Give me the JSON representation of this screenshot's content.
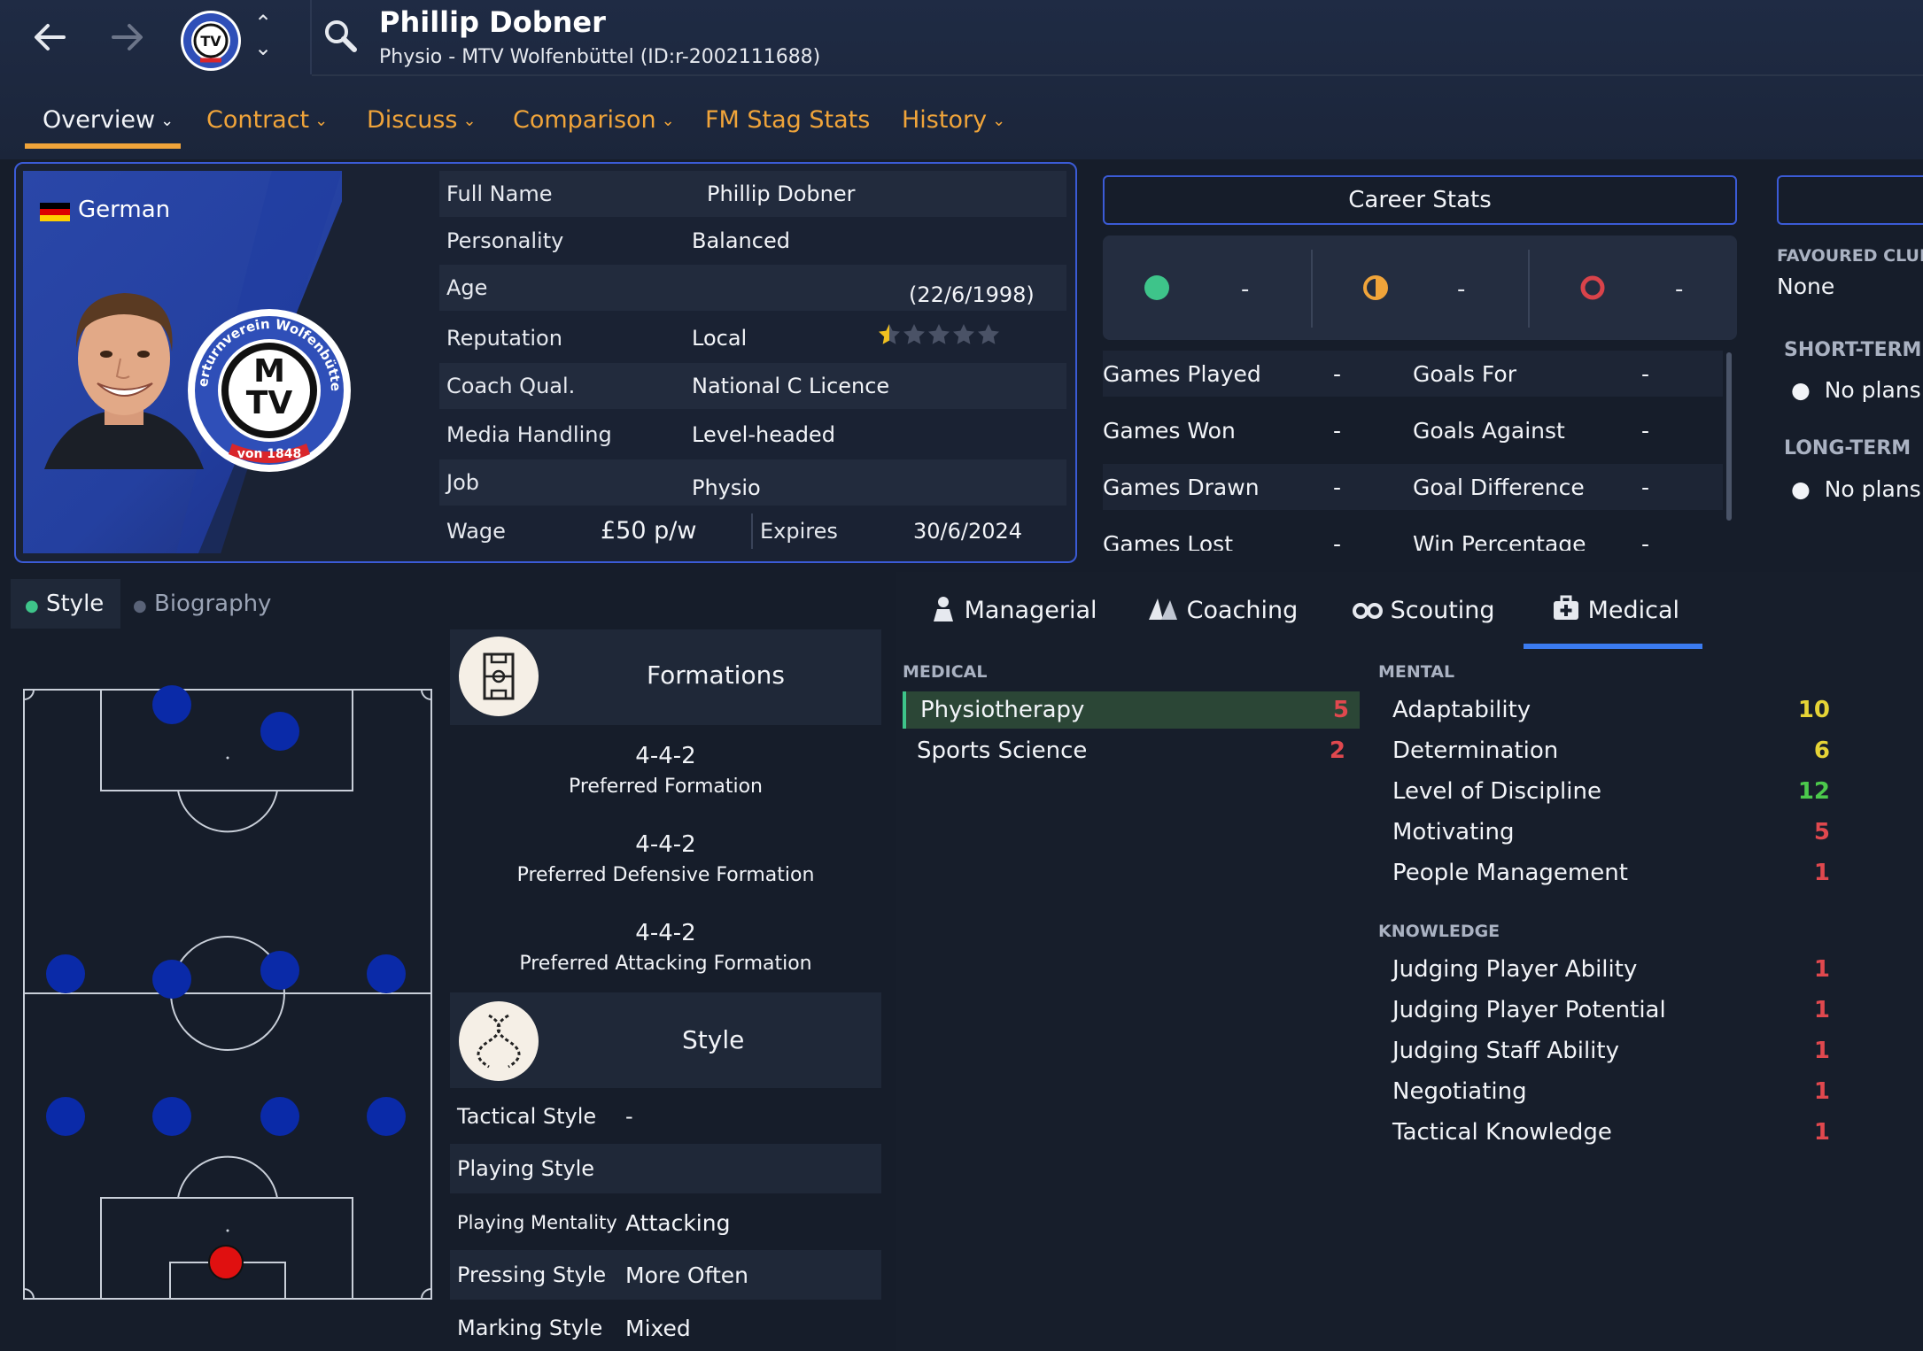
{
  "header": {
    "name": "Phillip Dobner",
    "subtitle": "Physio - MTV Wolfenbüttel (ID:r-2002111688)",
    "tabs": [
      {
        "label": "Overview",
        "dropdown": true,
        "active": true
      },
      {
        "label": "Contract",
        "dropdown": true
      },
      {
        "label": "Discuss",
        "dropdown": true
      },
      {
        "label": "Comparison",
        "dropdown": true
      },
      {
        "label": "FM Stag Stats",
        "dropdown": false
      },
      {
        "label": "History",
        "dropdown": true
      }
    ],
    "icons": {
      "back": "arrow-left-icon",
      "forward": "arrow-right-icon",
      "search": "search-icon"
    }
  },
  "profile": {
    "nationality": "German",
    "crest_text_top": "Männerturnverein Wolfenbüttel e.V.",
    "crest_text_bottom": "von 1848",
    "crest_letters": "MTV",
    "rows": [
      {
        "label": "Full Name",
        "value": "Phillip Dobner"
      },
      {
        "label": "Personality",
        "value": "Balanced"
      },
      {
        "label": "Age",
        "value": "(22/6/1998)"
      },
      {
        "label": "Reputation",
        "value": "Local",
        "stars": 0.5,
        "stars_max": 5
      },
      {
        "label": "Coach Qual.",
        "value": "National C Licence"
      },
      {
        "label": "Media Handling",
        "value": "Level-headed"
      },
      {
        "label": "Job",
        "value": "Physio"
      }
    ],
    "wage_label": "Wage",
    "wage_value": "£50 p/w",
    "expires_label": "Expires",
    "expires_value": "30/6/2024"
  },
  "career": {
    "button": "Career Stats",
    "results": [
      {
        "icon": "win-icon",
        "color": "#3ec48a",
        "value": "-"
      },
      {
        "icon": "draw-icon",
        "color": "#f0a43a",
        "value": "-"
      },
      {
        "icon": "loss-icon",
        "color": "#d9434a",
        "value": "-"
      }
    ],
    "stats": [
      {
        "left_label": "Games Played",
        "left_value": "-",
        "right_label": "Goals For",
        "right_value": "-"
      },
      {
        "left_label": "Games Won",
        "left_value": "-",
        "right_label": "Goals Against",
        "right_value": "-"
      },
      {
        "left_label": "Games Drawn",
        "left_value": "-",
        "right_label": "Goal Difference",
        "right_value": "-"
      },
      {
        "left_label": "Games Lost",
        "left_value": "-",
        "right_label": "Win Percentage",
        "right_value": "-"
      }
    ]
  },
  "right_column": {
    "favoured_club_label": "FAVOURED CLUB",
    "favoured_club_value": "None",
    "short_term_label": "SHORT-TERM",
    "short_term_value": "No plans",
    "long_term_label": "LONG-TERM",
    "long_term_value": "No plans"
  },
  "lower_left": {
    "tabs": [
      {
        "label": "Style",
        "active": true
      },
      {
        "label": "Biography",
        "active": false
      }
    ],
    "formations_title": "Formations",
    "formations": [
      {
        "value": "4-4-2",
        "label": "Preferred Formation"
      },
      {
        "value": "4-4-2",
        "label": "Preferred Defensive Formation"
      },
      {
        "value": "4-4-2",
        "label": "Preferred Attacking Formation"
      }
    ],
    "style_title": "Style",
    "style_rows": [
      {
        "label": "Tactical Style",
        "value": "-"
      },
      {
        "label": "Playing Style",
        "value": ""
      },
      {
        "label": "Playing Mentality",
        "value": "Attacking"
      },
      {
        "label": "Pressing Style",
        "value": "More Often"
      },
      {
        "label": "Marking Style",
        "value": "Mixed"
      }
    ],
    "pitch_colors": {
      "player": "#0a2aa8",
      "keeper": "#e01010"
    }
  },
  "attributes": {
    "tabs": [
      {
        "label": "Managerial",
        "icon": "manager-icon"
      },
      {
        "label": "Coaching",
        "icon": "coaching-icon"
      },
      {
        "label": "Scouting",
        "icon": "binoculars-icon"
      },
      {
        "label": "Medical",
        "icon": "medical-kit-icon",
        "active": true
      }
    ],
    "medical_header": "MEDICAL",
    "medical": [
      {
        "name": "Physiotherapy",
        "value": "5",
        "color": "#e0484e",
        "highlight": true
      },
      {
        "name": "Sports Science",
        "value": "2",
        "color": "#e0484e"
      }
    ],
    "mental_header": "MENTAL",
    "mental": [
      {
        "name": "Adaptability",
        "value": "10",
        "color": "#e6d436"
      },
      {
        "name": "Determination",
        "value": "6",
        "color": "#e6d436"
      },
      {
        "name": "Level of Discipline",
        "value": "12",
        "color": "#4cc94c"
      },
      {
        "name": "Motivating",
        "value": "5",
        "color": "#e0484e"
      },
      {
        "name": "People Management",
        "value": "1",
        "color": "#e0484e"
      }
    ],
    "knowledge_header": "KNOWLEDGE",
    "knowledge": [
      {
        "name": "Judging Player Ability",
        "value": "1",
        "color": "#e0484e"
      },
      {
        "name": "Judging Player Potential",
        "value": "1",
        "color": "#e0484e"
      },
      {
        "name": "Judging Staff Ability",
        "value": "1",
        "color": "#e0484e"
      },
      {
        "name": "Negotiating",
        "value": "1",
        "color": "#e0484e"
      },
      {
        "name": "Tactical Knowledge",
        "value": "1",
        "color": "#e0484e"
      }
    ]
  }
}
